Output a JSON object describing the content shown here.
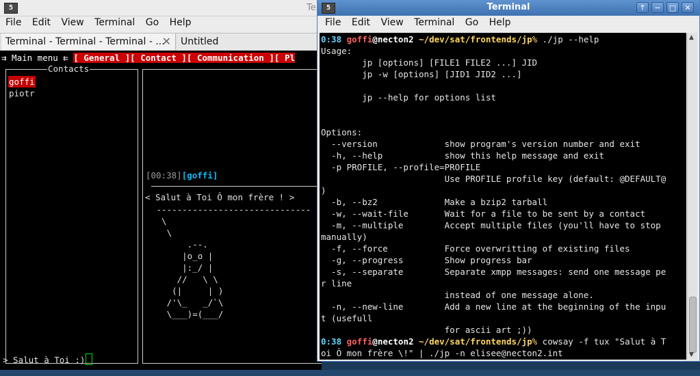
{
  "bg_window": {
    "icon": "5",
    "title": "Te",
    "menu": [
      "File",
      "Edit",
      "View",
      "Terminal",
      "Go",
      "Help"
    ],
    "tabs": [
      {
        "label": "Terminal - Terminal - Terminal - ..."
      },
      {
        "label": "Untitled"
      }
    ],
    "close_glyph": "✕",
    "term": {
      "main_menu": "⇉ Main menu ⇇ ",
      "menu_tabs": [
        "[ General ]",
        "[ Contact ]",
        "[ Communication ]",
        "[ Pl"
      ],
      "contacts_title": "Contacts",
      "contacts": [
        "goffi",
        "piotr"
      ],
      "chat_time": "[00:38]",
      "chat_nick": "[goffi]",
      "cow_text": "< Salut à Toi Ô mon frère ! >",
      "cow_art": " ------------------------------\n  \\\n   \\\n       .--.\n      |o_o |\n      |:_/ |\n     //   \\ \\\n    (|     | )\n   /'\\_   _/`\\\n   \\___)=(___/",
      "input": "> Salut à Toi :)"
    }
  },
  "fg_window": {
    "icon": "5",
    "title": "Terminal",
    "buttons": [
      "↑",
      "−",
      "□",
      "✕"
    ],
    "menu": [
      "File",
      "Edit",
      "View",
      "Terminal",
      "Go",
      "Help"
    ],
    "prompt": {
      "time": "0:38",
      "user": "goffi",
      "at": "@",
      "host": "necton2",
      "path": "~/dev/sat/frontends/jp",
      "symbol": "%"
    },
    "cmd1": " ./jp --help",
    "output": "Usage:\n        jp [options] [FILE1 FILE2 ...] JID\n        jp -w [options] [JID1 JID2 ...]\n\n        jp --help for options list\n\n\nOptions:\n  --version             show program's version number and exit\n  -h, --help            show this help message and exit\n  -p PROFILE, --profile=PROFILE\n                        Use PROFILE profile key (default: @DEFAULT@\n)\n  -b, --bz2             Make a bzip2 tarball\n  -w, --wait-file       Wait for a file to be sent by a contact\n  -m, --multiple        Accept multiple files (you'll have to stop\nmanually)\n  -f, --force           Force overwritting of existing files\n  -g, --progress        Show progress bar\n  -s, --separate        Separate xmpp messages: send one message pe\nr line\n                        instead of one message alone.\n  -n, --new-line        Add a new line at the beginning of the inpu\nt (usefull\n                        for ascii art ;))",
    "cmd2": " cowsay -f tux \"Salut à T",
    "cmd2_cont": "oi Ô mon frère \\!\" | ./jp -n elisee@necton2.int",
    "scroll_up": "▲",
    "scroll_down": "▼"
  }
}
